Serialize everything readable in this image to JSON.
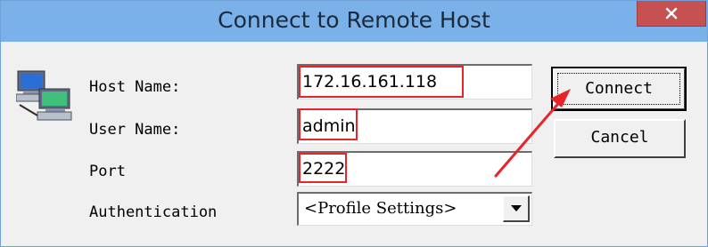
{
  "window": {
    "title": "Connect to Remote Host",
    "close_glyph": "✕"
  },
  "icons": {
    "host": "computer-network-icon",
    "close": "close-icon",
    "dropdown": "dropdown-arrow-icon"
  },
  "form": {
    "host_label": "Host Name:",
    "host_value": "172.16.161.118",
    "user_label": "User Name:",
    "user_value": "admin",
    "port_label": "Port",
    "port_value": "2222",
    "auth_label": "Authentication",
    "auth_value": "<Profile Settings>"
  },
  "buttons": {
    "connect": "Connect",
    "cancel": "Cancel"
  },
  "colors": {
    "titlebar": "#7ab1e8",
    "close": "#c75050",
    "highlight": "#e8242a"
  }
}
